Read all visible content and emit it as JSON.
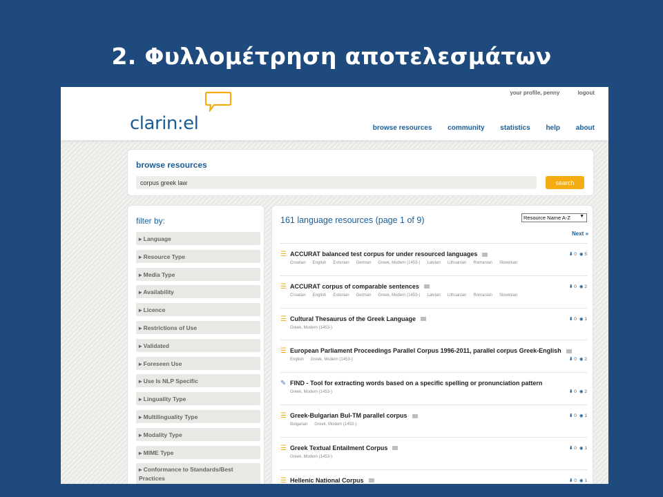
{
  "slide": {
    "title": "2. Φυλλομέτρηση αποτελεσμάτων"
  },
  "header": {
    "logo_text": "clarin:el",
    "top_links": [
      "your profile, penny",
      "logout"
    ],
    "nav": [
      "browse resources",
      "community",
      "statistics",
      "help",
      "about"
    ]
  },
  "search": {
    "title": "browse resources",
    "query": "corpus greek law",
    "button_label": "search"
  },
  "filters": {
    "title": "filter by:",
    "items": [
      "Language",
      "Resource Type",
      "Media Type",
      "Availability",
      "Licence",
      "Restrictions of Use",
      "Validated",
      "Foreseen Use",
      "Use Is NLP Specific",
      "Linguality Type",
      "Multilinguality Type",
      "Modality Type",
      "MIME Type",
      "Conformance to Standards/Best Practices"
    ]
  },
  "results": {
    "count_text": "161 language resources (page 1 of 9)",
    "sort_value": "Resource Name A-Z",
    "next_label": "Next »",
    "items": [
      {
        "title": "ACCURAT balanced test corpus for under resourced languages",
        "type": "corpus",
        "languages": [
          "Croatian",
          "English",
          "Estonian",
          "German",
          "Greek, Modern (1453-)",
          "Latvian",
          "Lithuanian",
          "Romanian",
          "Slovenian"
        ],
        "downloads": "0",
        "views": "5"
      },
      {
        "title": "ACCURAT corpus of comparable sentences",
        "type": "corpus",
        "languages": [
          "Croatian",
          "English",
          "Estonian",
          "German",
          "Greek, Modern (1453-)",
          "Latvian",
          "Lithuanian",
          "Romanian",
          "Slovenian"
        ],
        "downloads": "0",
        "views": "2"
      },
      {
        "title": "Cultural Thesaurus of the Greek Language",
        "type": "corpus",
        "languages": [
          "Greek, Modern (1453-)"
        ],
        "downloads": "0",
        "views": "1"
      },
      {
        "title": "European Parliament Proceedings Parallel Corpus 1996-2011, parallel corpus Greek-English",
        "type": "corpus",
        "languages": [
          "English",
          "Greek, Modern (1453-)"
        ],
        "downloads": "0",
        "views": "2"
      },
      {
        "title": "FIND - Tool for extracting words based on a specific spelling or pronunciation pattern",
        "type": "tool",
        "languages": [
          "Greek, Modern (1453-)"
        ],
        "downloads": "0",
        "views": "2"
      },
      {
        "title": "Greek-Bulgarian Bul-TM parallel corpus",
        "type": "corpus",
        "languages": [
          "Bulgarian",
          "Greek, Modern (1453-)"
        ],
        "downloads": "0",
        "views": "1"
      },
      {
        "title": "Greek Textual Entailment Corpus",
        "type": "corpus",
        "languages": [
          "Greek, Modern (1453-)"
        ],
        "downloads": "0",
        "views": "1"
      },
      {
        "title": "Hellenic National Corpus",
        "type": "corpus",
        "languages": [],
        "downloads": "0",
        "views": "1"
      }
    ]
  }
}
